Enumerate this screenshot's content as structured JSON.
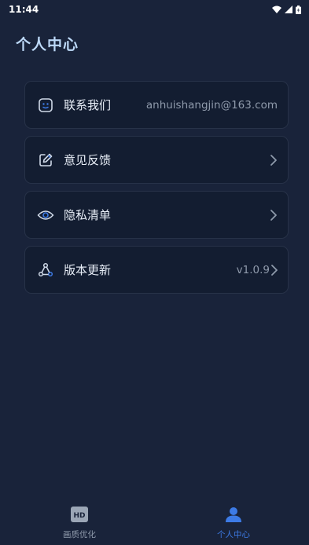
{
  "status_bar": {
    "time": "11:44"
  },
  "page_title": "个人中心",
  "menu": [
    {
      "label": "联系我们",
      "value": "anhuishangjin@163.com",
      "icon": "smiley-face-icon"
    },
    {
      "label": "意见反馈",
      "value": "",
      "icon": "edit-pencil-icon"
    },
    {
      "label": "隐私清单",
      "value": "",
      "icon": "eye-icon"
    },
    {
      "label": "版本更新",
      "value": "v1.0.9",
      "icon": "share-nodes-icon"
    }
  ],
  "bottom_nav": {
    "items": [
      {
        "label": "画质优化",
        "icon": "hd-icon",
        "active": false
      },
      {
        "label": "个人中心",
        "icon": "user-icon",
        "active": true
      }
    ]
  },
  "colors": {
    "background": "#19233a",
    "card_background": "#131d31",
    "accent": "#3d7be6",
    "title": "#bcd8f7"
  }
}
